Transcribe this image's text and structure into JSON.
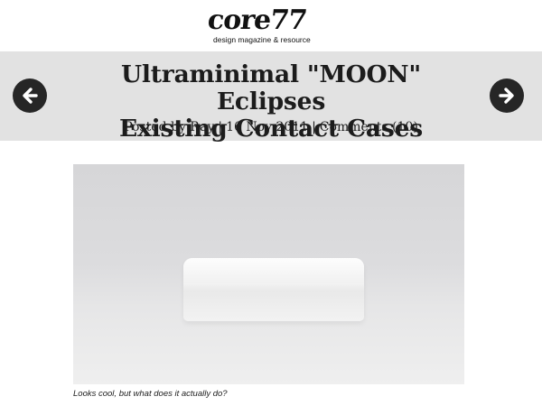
{
  "logo": {
    "text": "core77",
    "tagline": "design magazine & resource"
  },
  "article": {
    "title_line1": "Ultraminimal \"MOON\" Eclipses",
    "title_line2": "Existing Contact Cases",
    "posted_by": "Posted by Ray",
    "date": "16 Nov 2011",
    "comments": "Comments (10)",
    "separator": "|"
  },
  "nav": {
    "prev_icon": "arrow-left-icon",
    "next_icon": "arrow-right-icon"
  },
  "image": {
    "caption": "Looks cool, but what does it actually do?"
  },
  "colors": {
    "header_band": "#e2e2e2",
    "nav_button": "#262626",
    "text": "#1c1c1c"
  }
}
